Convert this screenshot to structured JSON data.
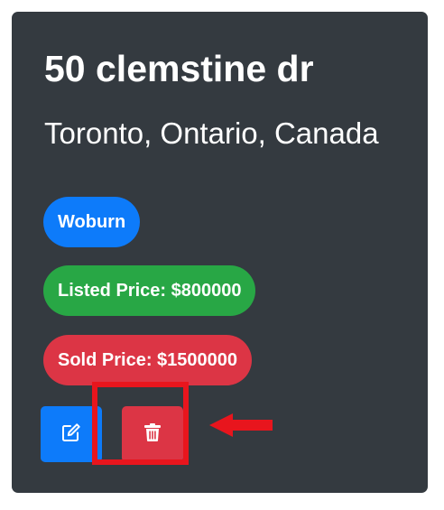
{
  "listing": {
    "address": "50 clemstine dr",
    "location": "Toronto, Ontario, Canada",
    "neighbourhood": "Woburn",
    "listed_price_label": "Listed Price: $800000",
    "sold_price_label": "Sold Price: $1500000"
  },
  "actions": {
    "edit_icon": "edit-icon",
    "delete_icon": "trash-icon"
  },
  "colors": {
    "card_bg": "#343a40",
    "badge_primary": "#0d7bfa",
    "badge_success": "#28a745",
    "badge_danger": "#dc3545",
    "highlight": "#e8151d"
  }
}
